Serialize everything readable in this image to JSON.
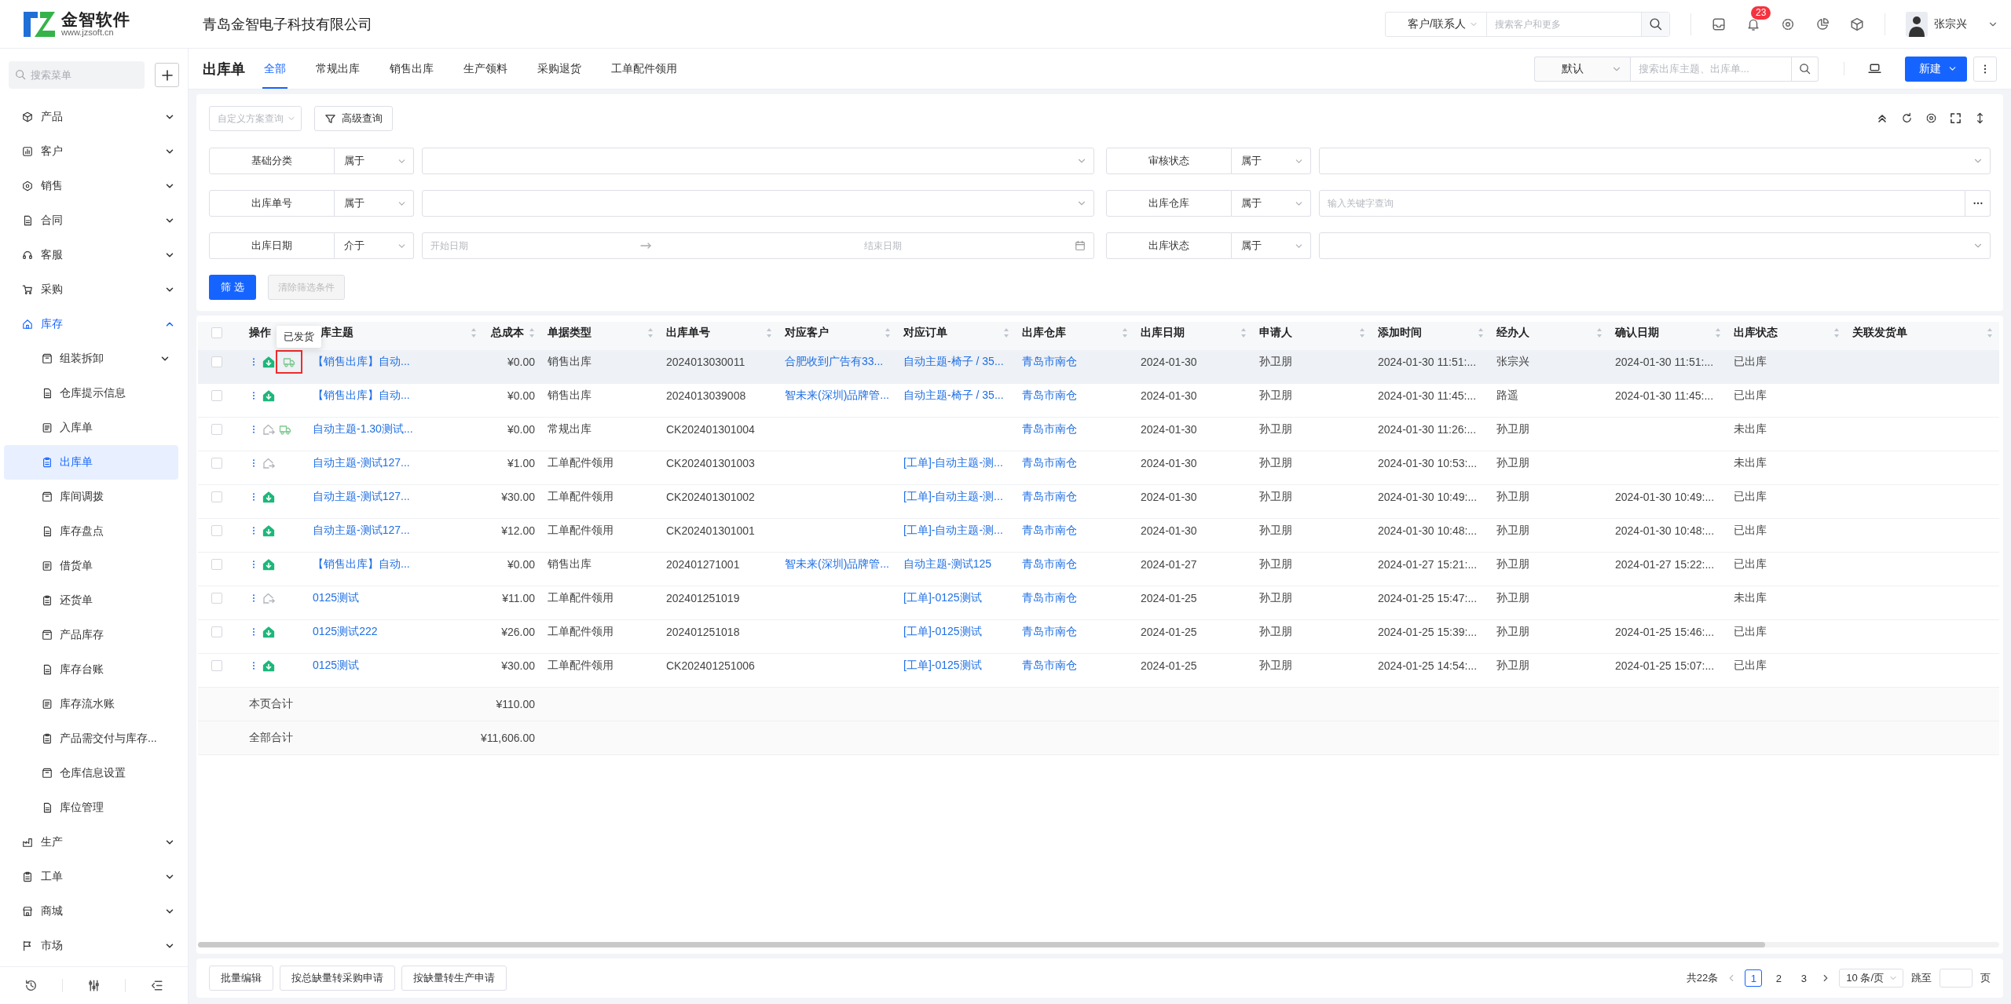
{
  "header": {
    "logo": {
      "name": "金智软件",
      "url": "www.jzsoft.cn"
    },
    "company": "青岛金智电子科技有限公司",
    "search": {
      "scope": "客户/联系人",
      "placeholder": "搜索客户和更多"
    },
    "notifications": "23",
    "user": "张宗兴"
  },
  "sidebar": {
    "search_placeholder": "搜索菜单",
    "items": [
      {
        "label": "产品",
        "expanded": false
      },
      {
        "label": "客户",
        "expanded": false
      },
      {
        "label": "销售",
        "expanded": false
      },
      {
        "label": "合同",
        "expanded": false
      },
      {
        "label": "客服",
        "expanded": false
      },
      {
        "label": "采购",
        "expanded": false
      },
      {
        "label": "库存",
        "expanded": true,
        "children": [
          {
            "label": "组装拆卸",
            "kind": "group",
            "selected": false
          },
          {
            "label": "仓库提示信息",
            "kind": "page",
            "selected": false
          },
          {
            "label": "入库单",
            "kind": "page",
            "selected": false
          },
          {
            "label": "出库单",
            "kind": "page",
            "selected": true
          },
          {
            "label": "库间调拨",
            "kind": "page",
            "selected": false
          },
          {
            "label": "库存盘点",
            "kind": "page",
            "selected": false
          },
          {
            "label": "借货单",
            "kind": "page",
            "selected": false
          },
          {
            "label": "还货单",
            "kind": "page",
            "selected": false
          },
          {
            "label": "产品库存",
            "kind": "page",
            "selected": false
          },
          {
            "label": "库存台账",
            "kind": "page",
            "selected": false
          },
          {
            "label": "库存流水账",
            "kind": "page",
            "selected": false
          },
          {
            "label": "产品需交付与库存...",
            "kind": "page",
            "selected": false
          },
          {
            "label": "仓库信息设置",
            "kind": "page",
            "selected": false
          },
          {
            "label": "库位管理",
            "kind": "page",
            "selected": false
          }
        ]
      },
      {
        "label": "生产",
        "expanded": false
      },
      {
        "label": "工单",
        "expanded": false
      },
      {
        "label": "商城",
        "expanded": false
      },
      {
        "label": "市场",
        "expanded": false
      }
    ]
  },
  "page": {
    "title": "出库单",
    "tabs": [
      {
        "label": "全部",
        "selected": true
      },
      {
        "label": "常规出库",
        "selected": false
      },
      {
        "label": "销售出库",
        "selected": false
      },
      {
        "label": "生产领料",
        "selected": false
      },
      {
        "label": "采购退货",
        "selected": false
      },
      {
        "label": "工单配件领用",
        "selected": false
      }
    ],
    "view": "默认",
    "search_placeholder": "搜索出库主题、出库单...",
    "new_button": "新建"
  },
  "filters": {
    "scheme_placeholder": "自定义方案查询",
    "advanced_button": "高级查询",
    "fields": [
      {
        "label": "基础分类",
        "operator": "属于",
        "kind": "select"
      },
      {
        "label": "审核状态",
        "operator": "属于",
        "kind": "select"
      },
      {
        "label": "出库单号",
        "operator": "属于",
        "kind": "select"
      },
      {
        "label": "出库仓库",
        "operator": "属于",
        "kind": "input",
        "placeholder": "输入关键字查询"
      },
      {
        "label": "出库日期",
        "operator": "介于",
        "kind": "date_range",
        "start_placeholder": "开始日期",
        "end_placeholder": "结束日期"
      },
      {
        "label": "出库状态",
        "operator": "属于",
        "kind": "select"
      }
    ],
    "apply_button": "筛 选",
    "clear_button": {
      "label": "清除筛选条件",
      "disabled": true
    }
  },
  "table": {
    "all_checked": false,
    "tooltip": "已发货",
    "columns": [
      {
        "label": "操作",
        "kind": "actions"
      },
      {
        "label": "库主题",
        "kind": "link",
        "sortable": true
      },
      {
        "label": "总成本",
        "kind": "money",
        "sortable": true
      },
      {
        "label": "单据类型",
        "kind": "text",
        "sortable": true
      },
      {
        "label": "出库单号",
        "kind": "text",
        "sortable": true
      },
      {
        "label": "对应客户",
        "kind": "link",
        "sortable": true
      },
      {
        "label": "对应订单",
        "kind": "link",
        "sortable": true
      },
      {
        "label": "出库仓库",
        "kind": "link",
        "sortable": true
      },
      {
        "label": "出库日期",
        "kind": "text",
        "sortable": true
      },
      {
        "label": "申请人",
        "kind": "text",
        "sortable": true
      },
      {
        "label": "添加时间",
        "kind": "text",
        "sortable": true
      },
      {
        "label": "经办人",
        "kind": "text",
        "sortable": true
      },
      {
        "label": "确认日期",
        "kind": "text",
        "sortable": true
      },
      {
        "label": "出库状态",
        "kind": "text",
        "sortable": true
      },
      {
        "label": "关联发货单",
        "kind": "text",
        "sortable": true
      }
    ],
    "rows": [
      {
        "checked": false,
        "hovered": true,
        "actions": [
          {
            "kind": "confirmed",
            "highlighted": false
          },
          {
            "kind": "shipment",
            "highlighted": true
          }
        ],
        "subject": "【销售出库】自动...",
        "cost": "¥0.00",
        "type": "销售出库",
        "number": "2024013030011",
        "customer": "合肥收到广告有33...",
        "order": "自动主题-椅子 / 35...",
        "warehouse": "青岛市南仓",
        "date": "2024-01-30",
        "applicant": "孙卫朋",
        "added": "2024-01-30 11:51:...",
        "handler": "张宗兴",
        "confirmed": "2024-01-30 11:51:...",
        "status": "已出库"
      },
      {
        "checked": false,
        "hovered": false,
        "actions": [
          {
            "kind": "confirmed",
            "highlighted": false
          }
        ],
        "subject": "【销售出库】自动...",
        "cost": "¥0.00",
        "type": "销售出库",
        "number": "2024013039008",
        "customer": "智未来(深圳)品牌管...",
        "order": "自动主题-椅子 / 35...",
        "warehouse": "青岛市南仓",
        "date": "2024-01-30",
        "applicant": "孙卫朋",
        "added": "2024-01-30 11:45:...",
        "handler": "路遥",
        "confirmed": "2024-01-30 11:45:...",
        "status": "已出库"
      },
      {
        "checked": false,
        "hovered": false,
        "actions": [
          {
            "kind": "pending",
            "highlighted": false
          },
          {
            "kind": "shipment",
            "highlighted": false
          }
        ],
        "subject": "自动主题-1.30测试...",
        "cost": "¥0.00",
        "type": "常规出库",
        "number": "CK202401301004",
        "warehouse": "青岛市南仓",
        "date": "2024-01-30",
        "applicant": "孙卫朋",
        "added": "2024-01-30 11:26:...",
        "handler": "孙卫朋",
        "status": "未出库"
      },
      {
        "checked": false,
        "hovered": false,
        "actions": [
          {
            "kind": "pending",
            "highlighted": false
          }
        ],
        "subject": "自动主题-测试127...",
        "cost": "¥1.00",
        "type": "工单配件领用",
        "number": "CK202401301003",
        "order": "[工单]-自动主题-测...",
        "warehouse": "青岛市南仓",
        "date": "2024-01-30",
        "applicant": "孙卫朋",
        "added": "2024-01-30 10:53:...",
        "handler": "孙卫朋",
        "status": "未出库"
      },
      {
        "checked": false,
        "hovered": false,
        "actions": [
          {
            "kind": "confirmed",
            "highlighted": false
          }
        ],
        "subject": "自动主题-测试127...",
        "cost": "¥30.00",
        "type": "工单配件领用",
        "number": "CK202401301002",
        "order": "[工单]-自动主题-测...",
        "warehouse": "青岛市南仓",
        "date": "2024-01-30",
        "applicant": "孙卫朋",
        "added": "2024-01-30 10:49:...",
        "handler": "孙卫朋",
        "confirmed": "2024-01-30 10:49:...",
        "status": "已出库"
      },
      {
        "checked": false,
        "hovered": false,
        "actions": [
          {
            "kind": "confirmed",
            "highlighted": false
          }
        ],
        "subject": "自动主题-测试127...",
        "cost": "¥12.00",
        "type": "工单配件领用",
        "number": "CK202401301001",
        "order": "[工单]-自动主题-测...",
        "warehouse": "青岛市南仓",
        "date": "2024-01-30",
        "applicant": "孙卫朋",
        "added": "2024-01-30 10:48:...",
        "handler": "孙卫朋",
        "confirmed": "2024-01-30 10:48:...",
        "status": "已出库"
      },
      {
        "checked": false,
        "hovered": false,
        "actions": [
          {
            "kind": "confirmed",
            "highlighted": false
          }
        ],
        "subject": "【销售出库】自动...",
        "cost": "¥0.00",
        "type": "销售出库",
        "number": "202401271001",
        "customer": "智未来(深圳)品牌管...",
        "order": "自动主题-测试125",
        "warehouse": "青岛市南仓",
        "date": "2024-01-27",
        "applicant": "孙卫朋",
        "added": "2024-01-27 15:21:...",
        "handler": "孙卫朋",
        "confirmed": "2024-01-27 15:22:...",
        "status": "已出库"
      },
      {
        "checked": false,
        "hovered": false,
        "actions": [
          {
            "kind": "pending",
            "highlighted": false
          }
        ],
        "subject": "0125测试",
        "cost": "¥11.00",
        "type": "工单配件领用",
        "number": "202401251019",
        "order": "[工单]-0125测试",
        "warehouse": "青岛市南仓",
        "date": "2024-01-25",
        "applicant": "孙卫朋",
        "added": "2024-01-25 15:47:...",
        "handler": "孙卫朋",
        "status": "未出库"
      },
      {
        "checked": false,
        "hovered": false,
        "actions": [
          {
            "kind": "confirmed",
            "highlighted": false
          }
        ],
        "subject": "0125测试222",
        "cost": "¥26.00",
        "type": "工单配件领用",
        "number": "202401251018",
        "order": "[工单]-0125测试",
        "warehouse": "青岛市南仓",
        "date": "2024-01-25",
        "applicant": "孙卫朋",
        "added": "2024-01-25 15:39:...",
        "handler": "孙卫朋",
        "confirmed": "2024-01-25 15:46:...",
        "status": "已出库"
      },
      {
        "checked": false,
        "hovered": false,
        "actions": [
          {
            "kind": "confirmed",
            "highlighted": false
          }
        ],
        "subject": "0125测试",
        "cost": "¥30.00",
        "type": "工单配件领用",
        "number": "CK202401251006",
        "order": "[工单]-0125测试",
        "warehouse": "青岛市南仓",
        "date": "2024-01-25",
        "applicant": "孙卫朋",
        "added": "2024-01-25 14:54:...",
        "handler": "孙卫朋",
        "confirmed": "2024-01-25 15:07:...",
        "status": "已出库"
      }
    ],
    "totals": [
      {
        "label": "本页合计",
        "cost": "¥110.00"
      },
      {
        "label": "全部合计",
        "cost": "¥11,606.00"
      }
    ]
  },
  "footer": {
    "actions": [
      "批量编辑",
      "按总缺量转采购申请",
      "按缺量转生产申请"
    ],
    "pagination": {
      "total": "共22条",
      "pages": [
        {
          "label": "1",
          "selected": true
        },
        {
          "label": "2",
          "selected": false
        },
        {
          "label": "3",
          "selected": false
        }
      ],
      "page_size": "10 条/页",
      "jump_label": "跳至",
      "jump_suffix": "页"
    }
  }
}
